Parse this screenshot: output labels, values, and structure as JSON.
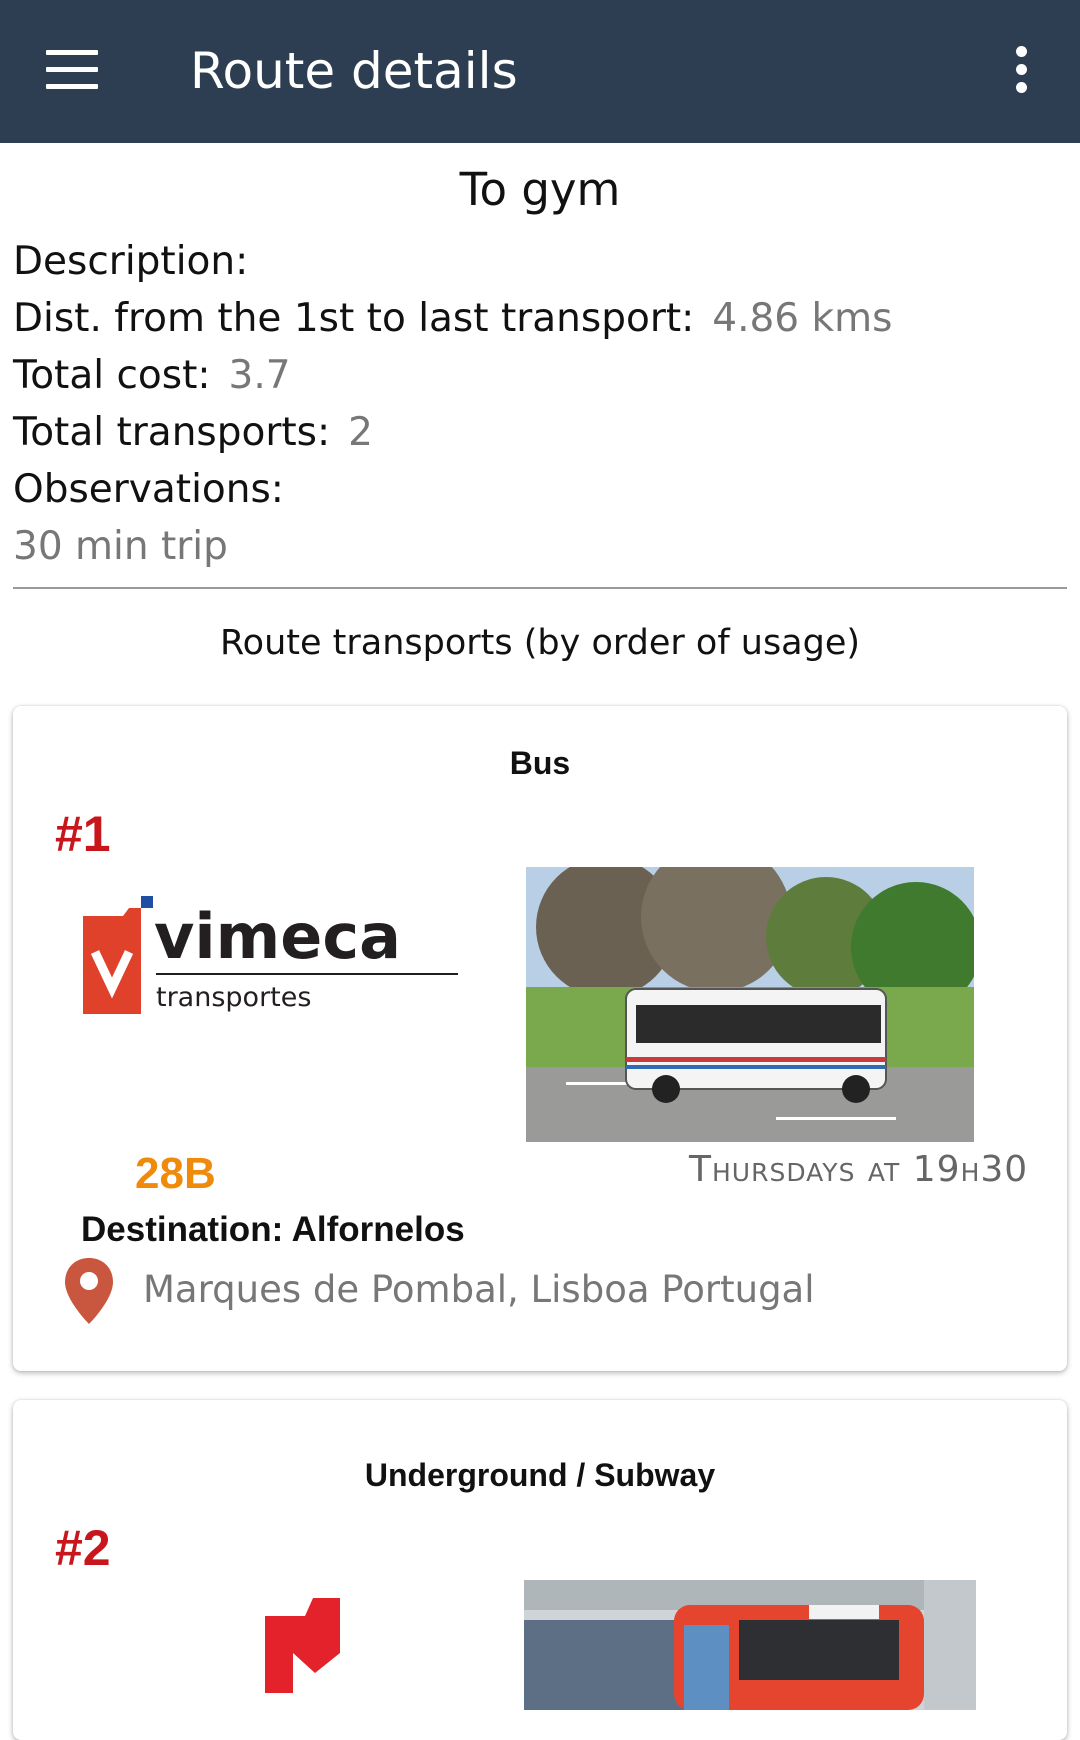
{
  "appbar": {
    "title": "Route details",
    "menu_icon": "menu-icon",
    "more_icon": "more-vert-icon",
    "background": "#2e3e52"
  },
  "route": {
    "name": "To gym",
    "description_label": "Description:",
    "description_value": "",
    "distance_label": "Dist. from the 1st to last transport:",
    "distance_value": "4.86 kms",
    "cost_label": "Total cost:",
    "cost_value": "3.7",
    "transports_label": "Total transports:",
    "transports_value": "2",
    "observations_label": "Observations:",
    "observations_value": "30 min trip"
  },
  "transports_section": {
    "title": "Route transports (by order of usage)",
    "items": [
      {
        "type": "Bus",
        "order": "#1",
        "operator_logo": {
          "name": "vimeca",
          "subtitle": "transportes"
        },
        "photo_icon": "bus-photo",
        "line": "28B",
        "schedule": "Thursdays at 19h30",
        "destination": "Destination: Alfornelos",
        "address": "Marques de Pombal, Lisboa Portugal",
        "location_icon": "location-pin-icon"
      },
      {
        "type": "Underground / Subway",
        "order": "#2",
        "operator_logo": {
          "name": "metro-logo"
        },
        "photo_icon": "subway-train-photo"
      }
    ]
  },
  "colors": {
    "order": "#c8161d",
    "line": "#f08a0b",
    "pin": "#c9573f",
    "vimeca_red": "#e0412a"
  }
}
